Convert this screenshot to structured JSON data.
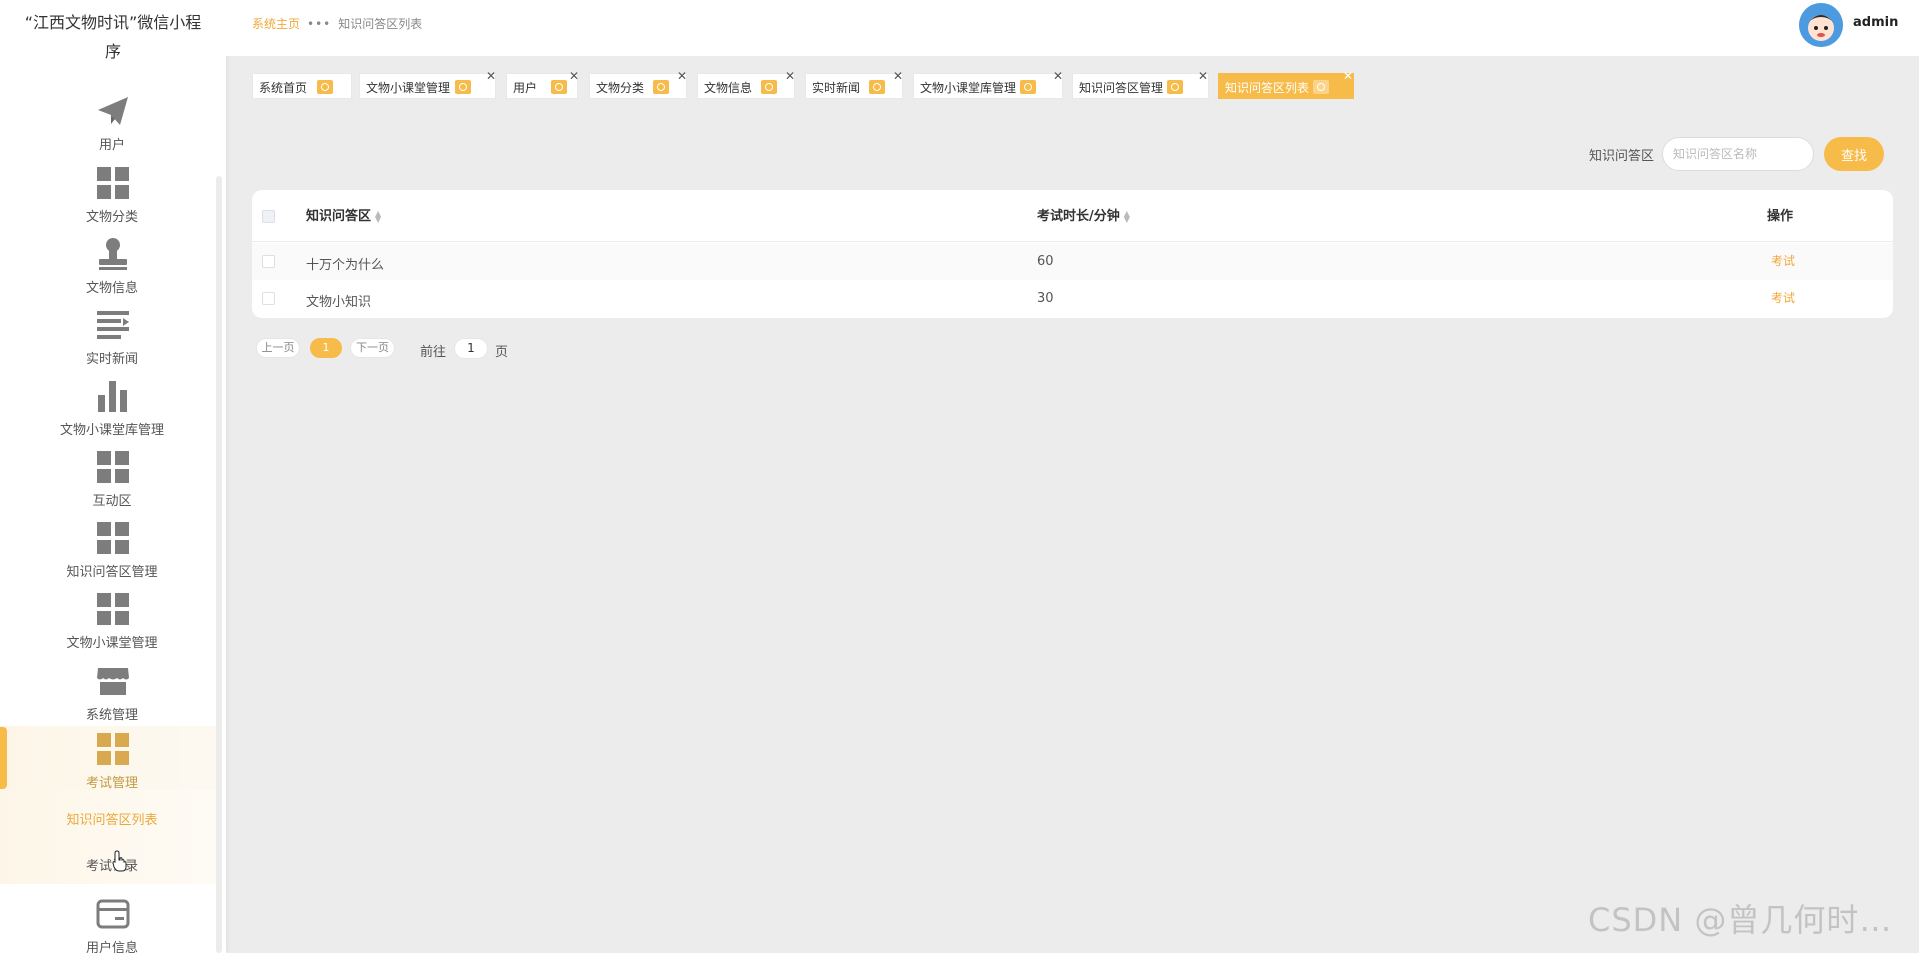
{
  "app": {
    "title": "“江西文物时讯”微信小程序"
  },
  "sidebar": {
    "items": [
      {
        "label": "用户",
        "icon": "paper-plane-icon"
      },
      {
        "label": "文物分类",
        "icon": "grid-icon"
      },
      {
        "label": "文物信息",
        "icon": "stamp-icon"
      },
      {
        "label": "实时新闻",
        "icon": "list-icon"
      },
      {
        "label": "文物小课堂库管理",
        "icon": "bar-chart-icon"
      },
      {
        "label": "互动区",
        "icon": "grid-icon"
      },
      {
        "label": "知识问答区管理",
        "icon": "grid-icon"
      },
      {
        "label": "文物小课堂管理",
        "icon": "grid-icon"
      },
      {
        "label": "系统管理",
        "icon": "store-icon"
      },
      {
        "label": "考试管理",
        "icon": "grid-icon"
      },
      {
        "label": "用户信息",
        "icon": "card-icon"
      }
    ],
    "submenu": [
      {
        "label": "知识问答区列表",
        "active": true
      },
      {
        "label": "考试记录",
        "active": false
      }
    ],
    "accent_color": "#f7bb4a"
  },
  "header": {
    "breadcrumb_home": "系统主页",
    "breadcrumb_sep": "•••",
    "breadcrumb_current": "知识问答区列表",
    "username": "admin"
  },
  "tags": [
    {
      "label": "系统首页",
      "closable": false
    },
    {
      "label": "文物小课堂管理",
      "closable": true
    },
    {
      "label": "用户",
      "closable": true
    },
    {
      "label": "文物分类",
      "closable": true
    },
    {
      "label": "文物信息",
      "closable": true
    },
    {
      "label": "实时新闻",
      "closable": true
    },
    {
      "label": "文物小课堂库管理",
      "closable": true
    },
    {
      "label": "知识问答区管理",
      "closable": true
    },
    {
      "label": "知识问答区列表",
      "closable": true,
      "active": true
    }
  ],
  "search": {
    "label": "知识问答区",
    "placeholder": "知识问答区名称",
    "button": "查找"
  },
  "table": {
    "columns": [
      "知识问答区",
      "考试时长/分钟",
      "操作"
    ],
    "rows": [
      {
        "name": "十万个为什么",
        "duration": "60",
        "action": "考试"
      },
      {
        "name": "文物小知识",
        "duration": "30",
        "action": "考试"
      }
    ]
  },
  "pagination": {
    "prev": "上一页",
    "current": "1",
    "next": "下一页",
    "goto_label": "前往",
    "goto_value": "1",
    "page_label": "页"
  },
  "watermark": "CSDN @曾几何时…"
}
